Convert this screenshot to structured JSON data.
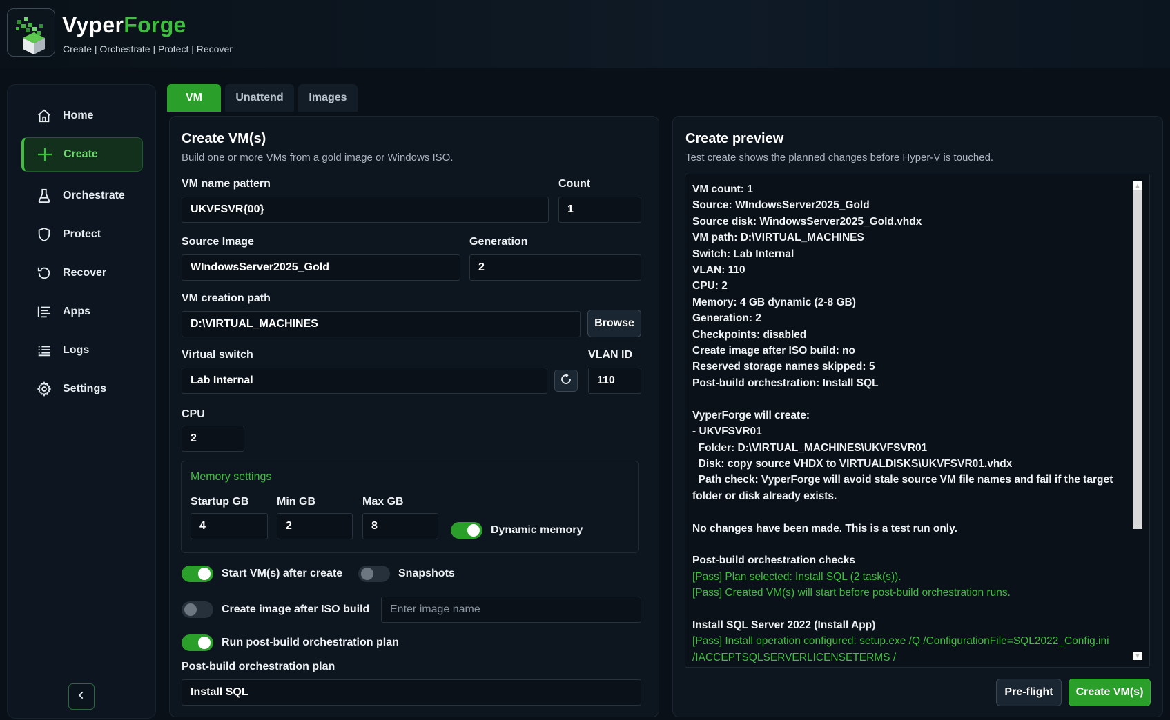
{
  "app": {
    "brand_part1": "Vyper",
    "brand_part2": "Forge",
    "tagline": "Create | Orchestrate | Protect | Recover"
  },
  "sidebar": {
    "items": [
      {
        "label": "Home",
        "icon": "home-icon"
      },
      {
        "label": "Create",
        "icon": "plus-icon",
        "active": true
      },
      {
        "label": "Orchestrate",
        "icon": "flask-icon"
      },
      {
        "label": "Protect",
        "icon": "shield-icon"
      },
      {
        "label": "Recover",
        "icon": "recover-icon"
      },
      {
        "label": "Apps",
        "icon": "apps-list-icon"
      },
      {
        "label": "Logs",
        "icon": "logs-list-icon"
      },
      {
        "label": "Settings",
        "icon": "gear-icon"
      }
    ],
    "collapse_icon": "chevron-left-icon"
  },
  "tabs": [
    {
      "label": "VM",
      "active": true
    },
    {
      "label": "Unattend"
    },
    {
      "label": "Images"
    }
  ],
  "create": {
    "title": "Create VM(s)",
    "subtitle": "Build one or more VMs from a gold image or Windows ISO.",
    "vm_name_pattern": {
      "label": "VM name pattern",
      "value": "UKVFSVR{00}"
    },
    "count": {
      "label": "Count",
      "value": "1"
    },
    "source_image": {
      "label": "Source Image",
      "value": "WIndowsServer2025_Gold"
    },
    "generation": {
      "label": "Generation",
      "value": "2"
    },
    "vm_path": {
      "label": "VM creation path",
      "value": "D:\\VIRTUAL_MACHINES"
    },
    "browse_label": "Browse",
    "virtual_switch": {
      "label": "Virtual switch",
      "value": "Lab Internal"
    },
    "vlan": {
      "label": "VLAN ID",
      "value": "110"
    },
    "cpu": {
      "label": "CPU",
      "value": "2"
    },
    "memory": {
      "title": "Memory settings",
      "startup": {
        "label": "Startup GB",
        "value": "4"
      },
      "min": {
        "label": "Min GB",
        "value": "2"
      },
      "max": {
        "label": "Max GB",
        "value": "8"
      },
      "dynamic_label": "Dynamic memory",
      "dynamic_on": true
    },
    "start_after_create": {
      "label": "Start VM(s) after create",
      "on": true
    },
    "snapshots": {
      "label": "Snapshots",
      "on": false
    },
    "create_image": {
      "label": "Create image after ISO build",
      "on": false
    },
    "image_name_placeholder": "Enter image name",
    "run_postbuild": {
      "label": "Run post-build orchestration plan",
      "on": true
    },
    "plan": {
      "label": "Post-build orchestration plan",
      "value": "Install SQL"
    }
  },
  "preview": {
    "title": "Create preview",
    "subtitle": "Test create shows the planned changes before Hyper-V is touched.",
    "lines": [
      {
        "text": "VM count: 1"
      },
      {
        "text": "Source: WIndowsServer2025_Gold"
      },
      {
        "text": "Source disk: WindowsServer2025_Gold.vhdx"
      },
      {
        "text": "VM path: D:\\VIRTUAL_MACHINES"
      },
      {
        "text": "Switch: Lab Internal"
      },
      {
        "text": "VLAN: 110"
      },
      {
        "text": "CPU: 2"
      },
      {
        "text": "Memory: 4 GB dynamic (2-8 GB)"
      },
      {
        "text": "Generation: 2"
      },
      {
        "text": "Checkpoints: disabled"
      },
      {
        "text": "Create image after ISO build: no"
      },
      {
        "text": "Reserved storage names skipped: 5"
      },
      {
        "text": "Post-build orchestration: Install SQL"
      },
      {
        "text": ""
      },
      {
        "text": "VyperForge will create:"
      },
      {
        "text": "- UKVFSVR01"
      },
      {
        "text": "  Folder: D:\\VIRTUAL_MACHINES\\UKVFSVR01"
      },
      {
        "text": "  Disk: copy source VHDX to VIRTUALDISKS\\UKVFSVR01.vhdx"
      },
      {
        "text": "  Path check: VyperForge will avoid stale source VM file names and fail if the target folder or disk already exists."
      },
      {
        "text": ""
      },
      {
        "text": "No changes have been made. This is a test run only."
      },
      {
        "text": ""
      },
      {
        "text": "Post-build orchestration checks"
      },
      {
        "text": "[Pass] Plan selected: Install SQL (2 task(s)).",
        "pass": true
      },
      {
        "text": "[Pass] Created VM(s) will start before post-build orchestration runs.",
        "pass": true
      },
      {
        "text": ""
      },
      {
        "text": "Install SQL Server 2022 (Install App)"
      },
      {
        "text": "[Pass] Install operation configured: setup.exe /Q /ConfigurationFile=SQL2022_Config.ini /IACCEPTSQLSERVERLICENSETERMS /",
        "pass": true
      }
    ],
    "preflight_label": "Pre-flight",
    "create_label": "Create VM(s)"
  },
  "colors": {
    "accent": "#2aa02a",
    "accent_text": "#3fbf3f",
    "background": "#0a1018",
    "panel": "#0d151e"
  }
}
